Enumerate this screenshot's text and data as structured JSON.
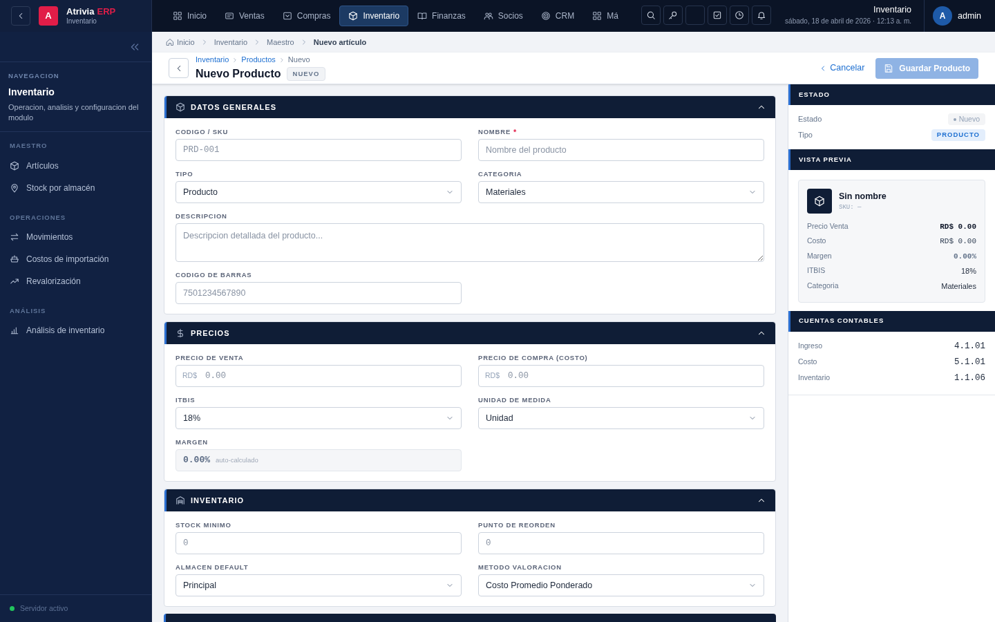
{
  "topbar": {
    "brand_letter": "A",
    "brand_name": "Atrivia",
    "brand_suffix": "ERP",
    "brand_subtitle": "Inventario",
    "nav": [
      {
        "label": "Inicio",
        "selected": false
      },
      {
        "label": "Ventas",
        "selected": false
      },
      {
        "label": "Compras",
        "selected": false
      },
      {
        "label": "Inventario",
        "selected": true
      },
      {
        "label": "Finanzas",
        "selected": false
      },
      {
        "label": "Socios",
        "selected": false
      },
      {
        "label": "CRM",
        "selected": false
      },
      {
        "label": "Má",
        "selected": false
      }
    ],
    "context_title": "Inventario",
    "context_date": "sábado, 18 de abril de 2026 · 12:13 a. m.",
    "user_initial": "A",
    "user_name": "admin"
  },
  "sidebar": {
    "heading": "NAVEGACION",
    "title": "Inventario",
    "description": "Operacion, analisis y configuracion del modulo",
    "sections": [
      {
        "title": "MAESTRO",
        "items": [
          {
            "label": "Artículos"
          },
          {
            "label": "Stock por almacén"
          }
        ]
      },
      {
        "title": "OPERACIONES",
        "items": [
          {
            "label": "Movimientos"
          },
          {
            "label": "Costos de importación"
          },
          {
            "label": "Revalorización"
          }
        ]
      },
      {
        "title": "ANÁLISIS",
        "items": [
          {
            "label": "Análisis de inventario"
          }
        ]
      }
    ],
    "status": "Servidor activo"
  },
  "breadcrumb": [
    "Inicio",
    "Inventario",
    "Maestro",
    "Nuevo artículo"
  ],
  "page": {
    "trail": [
      "Inventario",
      "Productos",
      "Nuevo"
    ],
    "title": "Nuevo Producto",
    "badge": "NUEVO",
    "cancel": "Cancelar",
    "save": "Guardar Producto",
    "save_disabled": true
  },
  "sections": [
    {
      "title": "DATOS GENERALES",
      "expanded": true,
      "fields": [
        {
          "label": "CODIGO / SKU",
          "kind": "code",
          "placeholder": "PRD-001"
        },
        {
          "label": "NOMBRE",
          "kind": "input",
          "placeholder": "Nombre del producto",
          "required_mark": "*"
        },
        {
          "label": "TIPO",
          "kind": "select",
          "value": "Producto"
        },
        {
          "label": "CATEGORIA",
          "kind": "select",
          "value": "Materiales"
        },
        {
          "label": "DESCRIPCION",
          "kind": "textarea",
          "placeholder": "Descripcion detallada del producto..."
        },
        {
          "label": "CODIGO DE BARRAS",
          "kind": "input",
          "placeholder": "7501234567890"
        }
      ]
    },
    {
      "title": "PRECIOS",
      "expanded": true,
      "fields": [
        {
          "label": "PRECIO DE VENTA",
          "kind": "prefixed",
          "prefix": "RD$",
          "placeholder": "0.00"
        },
        {
          "label": "PRECIO DE COMPRA (COSTO)",
          "kind": "prefixed",
          "prefix": "RD$",
          "placeholder": "0.00"
        },
        {
          "label": "ITBIS",
          "kind": "select",
          "value": "18%"
        },
        {
          "label": "UNIDAD DE MEDIDA",
          "kind": "select",
          "value": "Unidad"
        },
        {
          "label": "MARGEN",
          "kind": "computed",
          "value": "0.00%",
          "note": "auto-calculado"
        }
      ]
    },
    {
      "title": "INVENTARIO",
      "expanded": true,
      "fields": [
        {
          "label": "STOCK MINIMO",
          "kind": "code",
          "placeholder": "0"
        },
        {
          "label": "PUNTO DE REORDEN",
          "kind": "code",
          "placeholder": "0"
        },
        {
          "label": "ALMACEN DEFAULT",
          "kind": "select",
          "value": "Principal"
        },
        {
          "label": "METODO VALORACION",
          "kind": "select",
          "value": "Costo Promedio Ponderado"
        }
      ]
    }
  ],
  "panel": {
    "estado": {
      "title": "ESTADO",
      "rows": [
        {
          "label": "Estado",
          "value": "Nuevo",
          "kind": "status"
        },
        {
          "label": "Tipo",
          "value": "PRODUCTO",
          "kind": "tag"
        }
      ]
    },
    "preview": {
      "title": "VISTA PREVIA",
      "name": "Sin nombre",
      "sku": "SKU: —",
      "rows": [
        {
          "label": "Precio Venta",
          "value": "RD$ 0.00",
          "kind": "strong"
        },
        {
          "label": "Costo",
          "value": "RD$ 0.00",
          "kind": "mono"
        },
        {
          "label": "Margen",
          "value": "0.00%",
          "kind": "muted"
        },
        {
          "label": "ITBIS",
          "value": "18%",
          "kind": "plain"
        },
        {
          "label": "Categoria",
          "value": "Materiales",
          "kind": "plain"
        }
      ]
    },
    "accounts": {
      "title": "CUENTAS CONTABLES",
      "rows": [
        {
          "label": "Ingreso",
          "value": "4.1.01"
        },
        {
          "label": "Costo",
          "value": "5.1.01"
        },
        {
          "label": "Inventario",
          "value": "1.1.06"
        }
      ]
    }
  }
}
